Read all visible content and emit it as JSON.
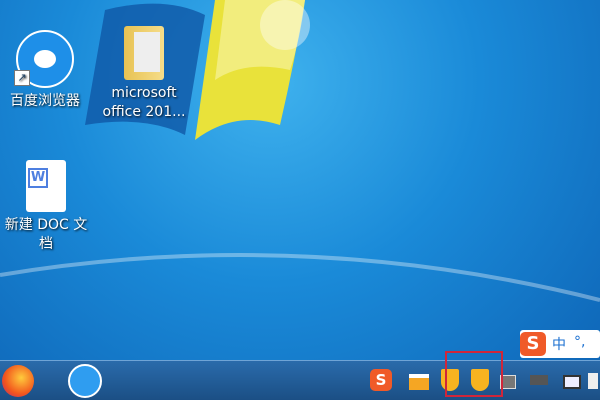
{
  "desktop": {
    "icons": [
      {
        "label": "百度浏览器"
      },
      {
        "label": "microsoft office 201..."
      },
      {
        "label": "新建 DOC 文档"
      }
    ]
  },
  "ime": {
    "logo": "S",
    "mode": "中",
    "punct": "°,"
  },
  "taskbar": {
    "apps": [
      "firefox",
      "baidu-browser"
    ],
    "tray": [
      "sogou",
      "notification",
      "security-shield",
      "security-shield-highlighted",
      "memory",
      "usb",
      "network",
      "volume"
    ],
    "sogou_letter": "S"
  },
  "colors": {
    "highlight": "#d0263a",
    "sogou": "#f05a28"
  }
}
